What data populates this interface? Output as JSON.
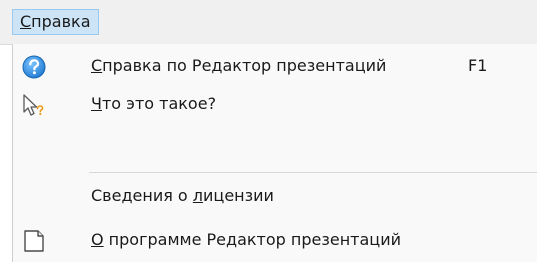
{
  "menubar": {
    "help_menu": {
      "underline": "С",
      "rest": "правка"
    }
  },
  "menu": {
    "items": [
      {
        "icon": "help-circle-icon",
        "underline": "С",
        "rest": "правка по Редактор презентаций",
        "shortcut": "F1"
      },
      {
        "icon": "whats-this-pointer-icon",
        "underline": "Ч",
        "rest": "то это такое?",
        "shortcut": ""
      },
      {
        "icon": "",
        "before": "Сведения о ",
        "underline": "л",
        "rest": "ицензии",
        "shortcut": ""
      },
      {
        "icon": "document-page-icon",
        "underline": "О",
        "rest": " программе Редактор презентаций",
        "shortcut": ""
      }
    ]
  },
  "colors": {
    "menubar_bg": "#f0f0f0",
    "active_menu_bg": "#cde4f7",
    "active_menu_border": "#99c9ef",
    "help_icon_blue": "#2f8fe0",
    "question_orange": "#e89a1c"
  }
}
